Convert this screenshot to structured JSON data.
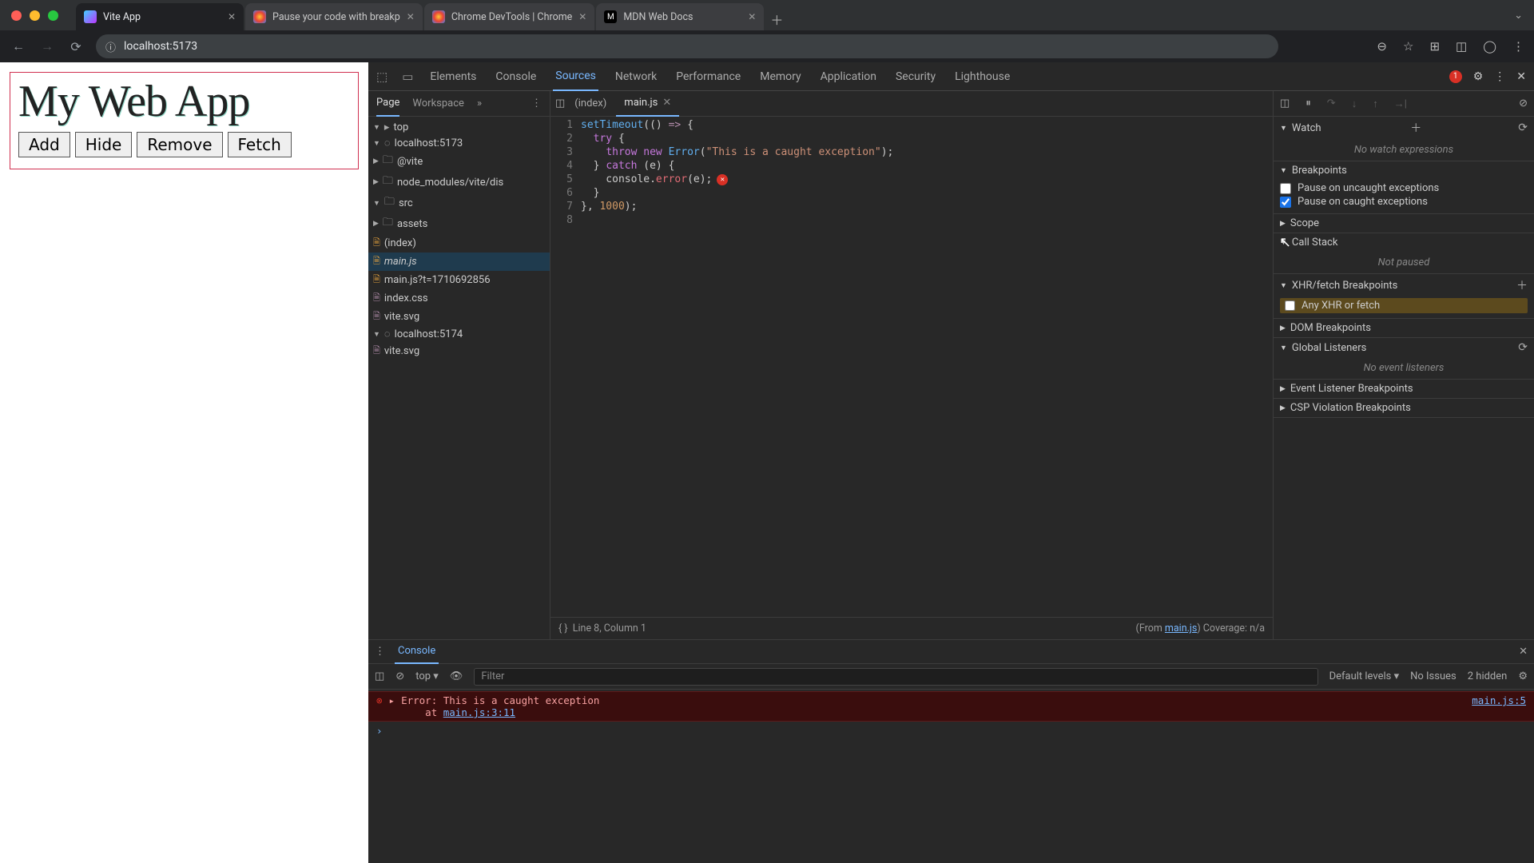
{
  "browser": {
    "tabs": [
      {
        "title": "Vite App"
      },
      {
        "title": "Pause your code with breakp"
      },
      {
        "title": "Chrome DevTools  |  Chrome"
      },
      {
        "title": "MDN Web Docs"
      }
    ],
    "url": "localhost:5173"
  },
  "page": {
    "title": "My Web App",
    "buttons": [
      "Add",
      "Hide",
      "Remove",
      "Fetch"
    ]
  },
  "devtools": {
    "panels": [
      "Elements",
      "Console",
      "Sources",
      "Network",
      "Performance",
      "Memory",
      "Application",
      "Security",
      "Lighthouse"
    ],
    "active_panel": "Sources",
    "error_count": "1",
    "navigator": {
      "tabs": [
        "Page",
        "Workspace"
      ],
      "tree": {
        "top": "top",
        "origins": [
          {
            "name": "localhost:5173",
            "children": [
              "@vite",
              "node_modules/vite/dis",
              {
                "name": "src",
                "children": [
                  "assets",
                  "(index)",
                  "main.js",
                  "main.js?t=1710692856",
                  "index.css",
                  "vite.svg"
                ]
              }
            ]
          },
          {
            "name": "localhost:5174",
            "children": [
              "vite.svg"
            ]
          }
        ]
      }
    },
    "editor": {
      "open_tabs": [
        "(index)",
        "main.js"
      ],
      "active": "main.js",
      "lines": [
        "setTimeout(() => {",
        "  try {",
        "    throw new Error(\"This is a caught exception\");",
        "  } catch (e) {",
        "    console.error(e);",
        "  }",
        "}, 1000);",
        ""
      ],
      "status_left": "Line 8, Column 1",
      "status_right_from": "(From ",
      "status_right_file": "main.js",
      "status_right_cov": ")  Coverage: n/a"
    },
    "sidebar": {
      "watch": {
        "title": "Watch",
        "empty": "No watch expressions"
      },
      "breakpoints": {
        "title": "Breakpoints",
        "uncaught": "Pause on uncaught exceptions",
        "caught": "Pause on caught exceptions"
      },
      "scope": "Scope",
      "callstack": {
        "title": "Call Stack",
        "empty": "Not paused"
      },
      "xhr": {
        "title": "XHR/fetch Breakpoints",
        "any": "Any XHR or fetch"
      },
      "dom": "DOM Breakpoints",
      "global": {
        "title": "Global Listeners",
        "empty": "No event listeners"
      },
      "event": "Event Listener Breakpoints",
      "csp": "CSP Violation Breakpoints"
    },
    "console": {
      "tab": "Console",
      "context": "top",
      "filter_placeholder": "Filter",
      "levels": "Default levels",
      "issues": "No Issues",
      "hidden": "2 hidden",
      "error": {
        "text": "Error: This is a caught exception\n    at ",
        "at": "main.js:3:11",
        "source": "main.js:5"
      }
    }
  }
}
